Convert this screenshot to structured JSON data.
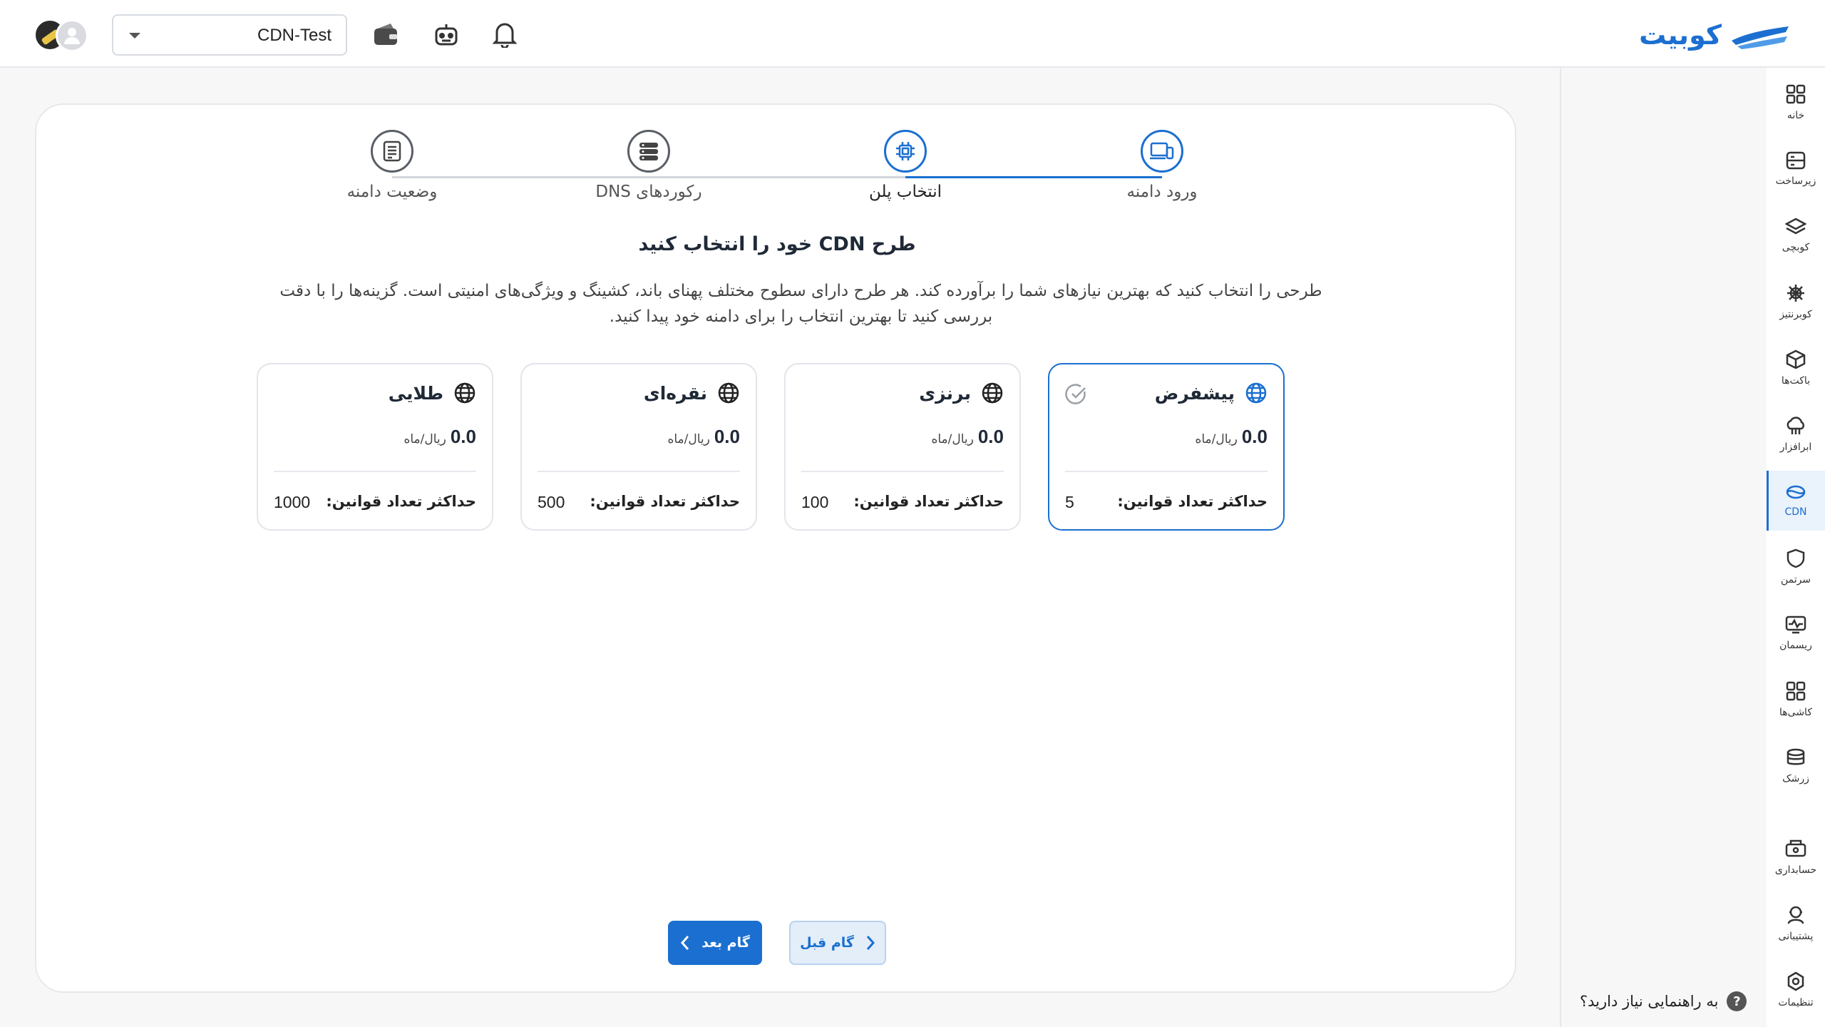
{
  "header": {
    "logo_text": "کوبیت",
    "project_selector": {
      "value": "CDN-Test"
    },
    "icons": [
      "wallet-icon",
      "robot-icon",
      "bell-icon"
    ]
  },
  "sidebar": {
    "items": [
      {
        "label": "خانه",
        "icon": "home-grid-icon"
      },
      {
        "label": "زیرساخت",
        "icon": "server-icon"
      },
      {
        "label": "کوبچی",
        "icon": "layers-icon"
      },
      {
        "label": "کوبرنتیز",
        "icon": "helm-icon"
      },
      {
        "label": "باکت‌ها",
        "icon": "box-icon"
      },
      {
        "label": "ابرافزار",
        "icon": "cloud-icon"
      },
      {
        "label": "CDN",
        "icon": "cdn-icon",
        "active": true
      },
      {
        "label": "سرتمن",
        "icon": "shield-icon"
      },
      {
        "label": "ریسمان",
        "icon": "monitor-icon"
      },
      {
        "label": "کاشی‌ها",
        "icon": "tiles-icon"
      },
      {
        "label": "زرشک",
        "icon": "stack-icon"
      },
      {
        "label": "حسابداری",
        "icon": "accounting-icon"
      },
      {
        "label": "پشتیبانی",
        "icon": "support-icon"
      },
      {
        "label": "تنظیمات",
        "icon": "settings-icon"
      }
    ],
    "help_text": "به راهنمایی نیاز دارید؟"
  },
  "stepper": {
    "steps": [
      {
        "label": "ورود دامنه",
        "icon": "domain-device-icon",
        "state": "done"
      },
      {
        "label": "انتخاب پلن",
        "icon": "chip-icon",
        "state": "current"
      },
      {
        "label": "رکوردهای DNS",
        "icon": "server-list-icon",
        "state": "pending"
      },
      {
        "label": "وضعیت دامنه",
        "icon": "document-icon",
        "state": "pending"
      }
    ]
  },
  "main": {
    "title": "طرح CDN خود را انتخاب کنید",
    "description_line1": "طرحی را انتخاب کنید که بهترین نیازهای شما را برآورده کند. هر طرح دارای سطوح مختلف پهنای باند، کشینگ و ویژگی‌های امنیتی است. گزینه‌ها را با دقت",
    "description_line2": "بررسی کنید تا بهترین انتخاب را برای دامنه خود پیدا کنید.",
    "plans": [
      {
        "name": "پیشفرض",
        "price": "0.0",
        "unit": "ریال/ماه",
        "rules_label": "حداکثر تعداد قوانین:",
        "rules_value": "5",
        "selected": true
      },
      {
        "name": "برنزی",
        "price": "0.0",
        "unit": "ریال/ماه",
        "rules_label": "حداکثر تعداد قوانین:",
        "rules_value": "100",
        "selected": false
      },
      {
        "name": "نقره‌ای",
        "price": "0.0",
        "unit": "ریال/ماه",
        "rules_label": "حداکثر تعداد قوانین:",
        "rules_value": "500",
        "selected": false
      },
      {
        "name": "طلایی",
        "price": "0.0",
        "unit": "ریال/ماه",
        "rules_label": "حداکثر تعداد قوانین:",
        "rules_value": "1000",
        "selected": false
      }
    ],
    "next_label": "گام بعد",
    "prev_label": "گام قبل"
  },
  "colors": {
    "accent": "#1b6fd0",
    "border": "#e2e5ea"
  }
}
